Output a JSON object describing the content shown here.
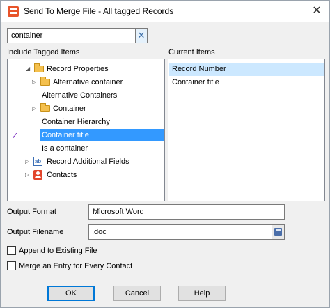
{
  "window": {
    "title": "Send To Merge File - All tagged Records",
    "close_glyph": "✕"
  },
  "search": {
    "value": "container",
    "clear_glyph": "✕"
  },
  "labels": {
    "include_tagged_items": "Include Tagged Items",
    "current_items": "Current Items",
    "output_format": "Output Format",
    "output_filename": "Output Filename",
    "append_to_existing": "Append to Existing File",
    "merge_entry_every_contact": "Merge an Entry for Every Contact"
  },
  "tree": {
    "items": [
      {
        "label": "Record Properties"
      },
      {
        "label": "Alternative container"
      },
      {
        "label": "Alternative Containers"
      },
      {
        "label": "Container"
      },
      {
        "label": "Container Hierarchy"
      },
      {
        "label": "Container title"
      },
      {
        "label": "Is a container"
      },
      {
        "label": "Record Additional Fields"
      },
      {
        "label": "Contacts"
      }
    ],
    "selected_item": "Container title",
    "checked_glyph": "✓"
  },
  "current_items": [
    {
      "label": "Record Number"
    },
    {
      "label": "Container title"
    }
  ],
  "output_format": {
    "value": "Microsoft Word"
  },
  "output_filename": {
    "value": ".doc"
  },
  "options": {
    "append_checked": false,
    "merge_checked": false
  },
  "buttons": {
    "ok": "OK",
    "cancel": "Cancel",
    "help": "Help"
  },
  "icons": {
    "app": "merge-document-icon",
    "folder": "folder-icon",
    "field": "text-field-icon",
    "contact": "contact-icon",
    "save": "save-disk-icon"
  },
  "colors": {
    "selection": "#3399ff",
    "list_selection": "#cce8ff",
    "default_button_border": "#0078d7"
  }
}
